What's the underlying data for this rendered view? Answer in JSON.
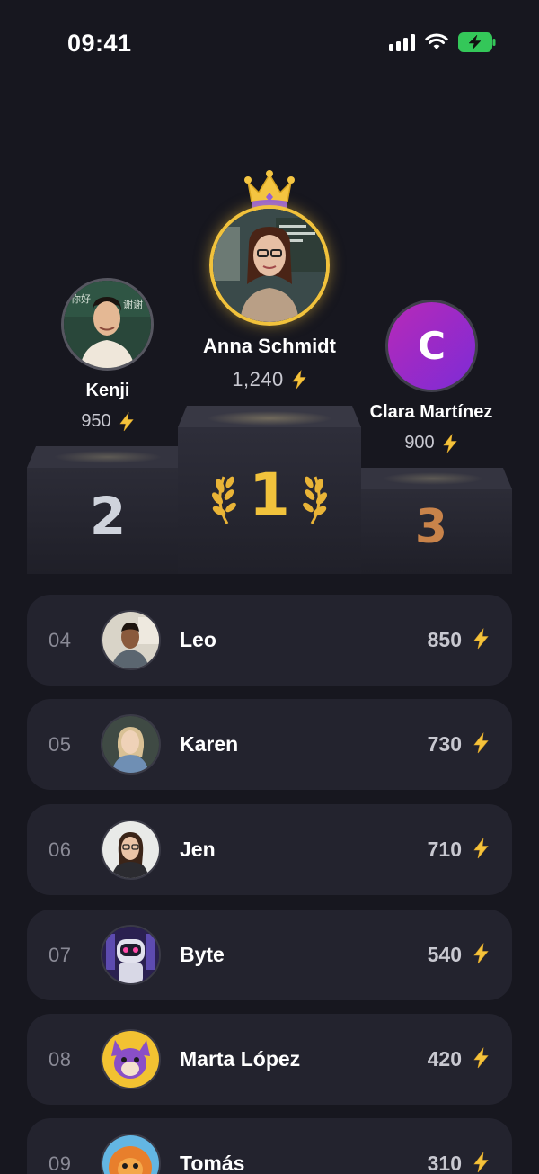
{
  "status": {
    "time": "09:41"
  },
  "podium": {
    "first": {
      "rank": "1",
      "name": "Anna Schmidt",
      "score": "1,240"
    },
    "second": {
      "rank": "2",
      "name": "Kenji",
      "score": "950"
    },
    "third": {
      "rank": "3",
      "name": "Clara Martínez",
      "score": "900",
      "initial": "C"
    }
  },
  "leaderboard": [
    {
      "rank": "04",
      "name": "Leo",
      "score": "850"
    },
    {
      "rank": "05",
      "name": "Karen",
      "score": "730"
    },
    {
      "rank": "06",
      "name": "Jen",
      "score": "710"
    },
    {
      "rank": "07",
      "name": "Byte",
      "score": "540"
    },
    {
      "rank": "08",
      "name": "Marta López",
      "score": "420"
    },
    {
      "rank": "09",
      "name": "Tomás",
      "score": "310"
    }
  ],
  "icons": {
    "score": "lightning-bolt-icon",
    "first_place": "crown-icon",
    "laurel": "laurel-wreath-icon"
  },
  "colors": {
    "background": "#17171f",
    "card": "#23232e",
    "gold": "#f5c33b",
    "silver": "#cfd3dc",
    "bronze": "#c8834a",
    "third_avatar": "#9b2bd1"
  }
}
